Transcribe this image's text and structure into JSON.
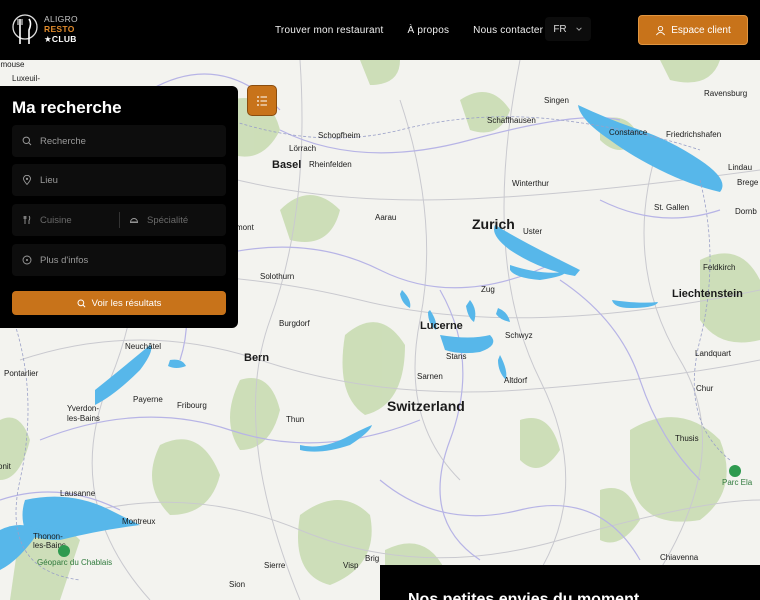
{
  "brand": {
    "logo_lines": [
      "ALIGRO",
      "RESTO",
      "★CLUB"
    ],
    "accent": "#c8731a"
  },
  "nav": {
    "items": [
      "Trouver mon restaurant",
      "À propos",
      "Nous contacter"
    ]
  },
  "language": {
    "selected": "FR",
    "icon": "chevron-down-icon"
  },
  "client_button": {
    "label": "Espace client",
    "icon": "user-icon"
  },
  "search": {
    "title": "Ma recherche",
    "query_placeholder": "Recherche",
    "location_placeholder": "Lieu",
    "cuisine_placeholder": "Cuisine",
    "specialty_placeholder": "Spécialité",
    "more_placeholder": "Plus d'infos",
    "submit_label": "Voir les résultats"
  },
  "map": {
    "labels": {
      "remouse": "emouse",
      "luxeuil": "Luxeuil-",
      "singen": "Singen",
      "ravensburg": "Ravensburg",
      "schaffhausen": "Schaffhausen",
      "constance": "Constance",
      "friedrichshafen": "Friedrichshafen",
      "schopfheim": "Schopfheim",
      "lorrach": "Lörrach",
      "basel": "Basel",
      "rheinfelden": "Rheinfelden",
      "lindau": "Lindau",
      "brege": "Brege",
      "winterthur": "Winterthur",
      "stgallen": "St. Gallen",
      "dornb": "Dornb",
      "aarau": "Aarau",
      "zurich": "Zurich",
      "uster": "Uster",
      "mont": "mont",
      "feldkirch": "Feldkirch",
      "solothurn": "Solothurn",
      "zug": "Zug",
      "liechtenstein": "Liechtenstein",
      "burgdorf": "Burgdorf",
      "lucerne": "Lucerne",
      "schwyz": "Schwyz",
      "neuchatel": "Neuchâtel",
      "bern": "Bern",
      "stans": "Stans",
      "landquart": "Landquart",
      "pontarlier": "Pontarlier",
      "sarnen": "Sarnen",
      "altdorf": "Altdorf",
      "chur": "Chur",
      "payerne": "Payerne",
      "switzerland": "Switzerland",
      "yverdon": "Yverdon-",
      "lesbains": "les-Bains",
      "fribourg": "Fribourg",
      "thun": "Thun",
      "thusis": "Thusis",
      "onit": "onit",
      "lausanne": "Lausanne",
      "montreux": "Montreux",
      "thonon": "Thonon-",
      "lesbains2": "les-Bains",
      "chiavenna": "Chiavenna",
      "brig": "Brig",
      "sierre": "Sierre",
      "visp": "Visp",
      "sion": "Sion",
      "parc_ela": "Parc Ela",
      "geoparc": "Géoparc du Chablais"
    }
  },
  "bottom_card": {
    "text": "Nos petites envies du moment"
  }
}
